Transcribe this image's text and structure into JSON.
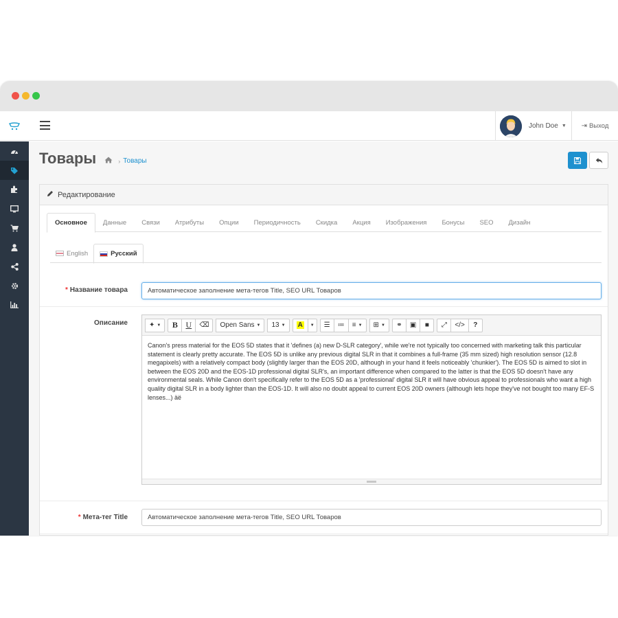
{
  "header": {
    "user_name": "John Doe",
    "logout_label": "Выход"
  },
  "sidebar": {
    "items": [
      {
        "icon": "dashboard-icon",
        "glyph": "◕"
      },
      {
        "icon": "tag-icon",
        "glyph": "◆"
      },
      {
        "icon": "puzzle-icon",
        "glyph": "✚"
      },
      {
        "icon": "monitor-icon",
        "glyph": "▭"
      },
      {
        "icon": "cart-icon",
        "glyph": "⛟"
      },
      {
        "icon": "user-icon",
        "glyph": "●"
      },
      {
        "icon": "share-icon",
        "glyph": "⋖"
      },
      {
        "icon": "cog-icon",
        "glyph": "✹"
      },
      {
        "icon": "bar-chart-icon",
        "glyph": "▮"
      }
    ]
  },
  "page": {
    "title": "Товары",
    "breadcrumb_current": "Товары"
  },
  "panel": {
    "heading": "Редактирование"
  },
  "tabs": [
    "Основное",
    "Данные",
    "Связи",
    "Атрибуты",
    "Опции",
    "Периодичность",
    "Скидка",
    "Акция",
    "Изображения",
    "Бонусы",
    "SEO",
    "Дизайн"
  ],
  "lang_tabs": [
    "English",
    "Русский"
  ],
  "form": {
    "name_label": "Название товара",
    "name_value": "Автоматическое заполнение мета-тегов Title, SEO URL Товаров",
    "description_label": "Описание",
    "description_text": "Canon's press material for the EOS 5D states that it 'defines (a) new D-SLR category', while we're not typically too concerned with marketing talk this particular statement is clearly pretty accurate. The EOS 5D is unlike any previous digital SLR in that it combines a full-frame (35 mm sized) high resolution sensor (12.8 megapixels) with a relatively compact body (slightly larger than the EOS 20D, although in your hand it feels noticeably 'chunkier'). The EOS 5D is aimed to slot in between the EOS 20D and the EOS-1D professional digital SLR's, an important difference when compared to the latter is that the EOS 5D doesn't have any environmental seals. While Canon don't specifically refer to the EOS 5D as a 'professional' digital SLR it will have obvious appeal to professionals who want a high quality digital SLR in a body lighter than the EOS-1D. It will also no doubt appeal to current EOS 20D owners (although lets hope they've not bought too many EF-S lenses...) äë",
    "meta_title_label": "Мета-тег Title",
    "meta_title_value": "Автоматическое заполнение мета-тегов Title, SEO URL Товаров"
  },
  "editor_toolbar": {
    "font_name": "Open Sans",
    "font_size": "13"
  },
  "colors": {
    "sidebar_bg": "#2b3643",
    "accent": "#1e91cf",
    "required": "#e33333"
  }
}
